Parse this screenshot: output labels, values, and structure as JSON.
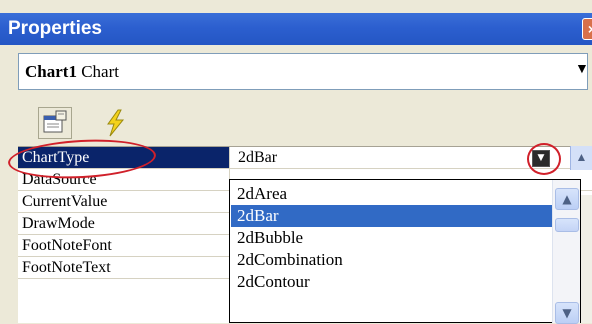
{
  "window": {
    "title": "Properties",
    "close_label": "×"
  },
  "object_selector": {
    "name": "Chart1",
    "type": "Chart"
  },
  "toolbar": {
    "properties_icon": "property-pages-icon",
    "events_icon": "lightning-icon"
  },
  "grid": {
    "rows": [
      {
        "name": "ChartType",
        "value": "2dBar"
      },
      {
        "name": "DataSource",
        "value": ""
      },
      {
        "name": "CurrentValue",
        "value": ""
      },
      {
        "name": "DrawMode",
        "value": ""
      },
      {
        "name": "FootNoteFont",
        "value": ""
      },
      {
        "name": "FootNoteText",
        "value": ""
      }
    ],
    "selected_row": "ChartType"
  },
  "dropdown": {
    "items": [
      "2dArea",
      "2dBar",
      "2dBubble",
      "2dCombination",
      "2dContour"
    ],
    "selected": "2dBar"
  },
  "annotations": {
    "color": "#d0202a",
    "shape": "ellipse"
  },
  "colors": {
    "titlebar": "#2c5fcf",
    "selection": "#0a246a",
    "list_selection": "#316ac5"
  }
}
